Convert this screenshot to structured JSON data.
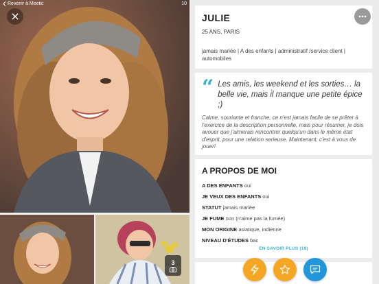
{
  "status_bar": {
    "back_label": "Revenir à Meetic",
    "time": "10"
  },
  "photos": {
    "main_alt": "Photo principale",
    "count": "3",
    "main_color": "#6f4a3a",
    "icons": [
      "close-icon",
      "more-icon",
      "camera-icon"
    ]
  },
  "profile": {
    "name": "JULIE",
    "age_city": "25 ANS, PARIS",
    "tags": "jamais mariée | A des enfants | administratif /service client | automobiles"
  },
  "quote": {
    "headline": "Les amis, les weekend et les sorties… la belle vie, mais il manque une petite épice ;)",
    "description": "Calme, souriante et franche, ce n'est jamais facile de se prêter à l'exercice de la description personnelle, mais pour résumer, je dois avouer que j'aimerais rencontrer quelqu'un dans le même état d'esprit, pour une relation serieuse. Maintenant, c'est à vous de jouer!"
  },
  "about": {
    "title": "A PROPOS DE MOI",
    "rows": [
      {
        "key": "A DES ENFANTS",
        "value": "oui"
      },
      {
        "key": "JE VEUX DES ENFANTS",
        "value": "oui"
      },
      {
        "key": "STATUT",
        "value": "jamais mariée"
      },
      {
        "key": "JE FUME",
        "value": "non (n'aime pas la fumée)"
      },
      {
        "key": "MON ORIGINE",
        "value": "asiatique, indienne"
      },
      {
        "key": "NIVEAU D'ÉTUDES",
        "value": "bac"
      }
    ],
    "see_more": "EN SAVOIR PLUS (19)"
  },
  "actions": {
    "icons": [
      "flash-icon",
      "star-icon",
      "chat-icon"
    ],
    "colors": {
      "flash": "#f5a623",
      "favorite": "#f5a623",
      "message": "#2196d9"
    }
  },
  "theme": {
    "accent": "#3ab3c9",
    "background": "#ececec"
  }
}
